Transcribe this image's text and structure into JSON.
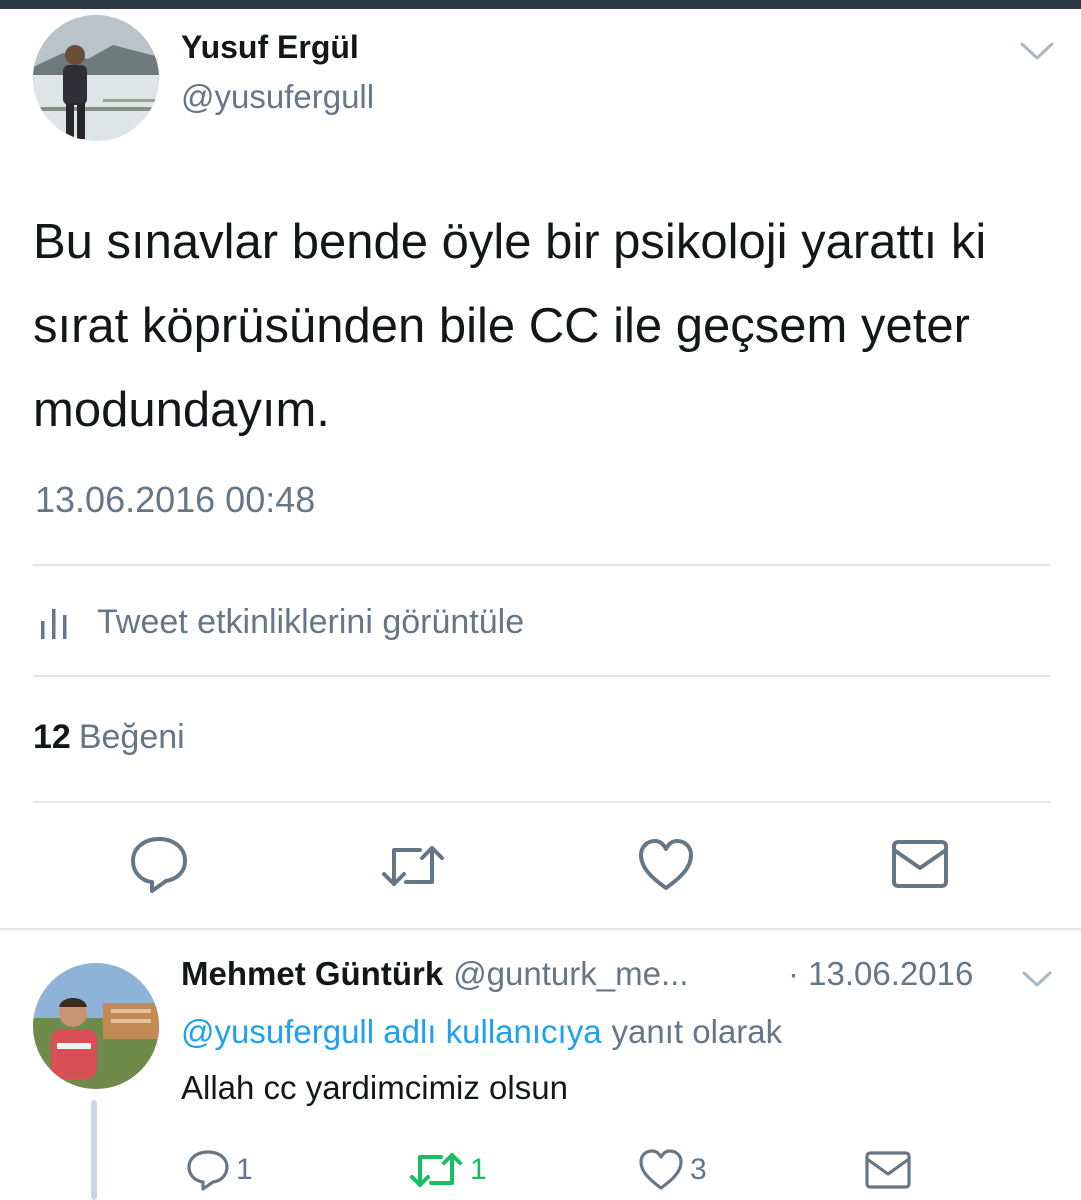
{
  "tweet": {
    "author_name": "Yusuf Ergül",
    "author_handle": "@yusufergull",
    "text": "Bu sınavlar bende öyle bir psikoloji yarattı ki sırat köprüsünden bile CC ile geçsem yeter modundayım.",
    "timestamp": "13.06.2016 00:48",
    "activity_label": "Tweet etkinliklerini görüntüle",
    "likes_count": "12",
    "likes_label": "Beğeni",
    "actions": [
      "reply-icon",
      "retweet-icon",
      "like-icon",
      "message-icon"
    ]
  },
  "reply": {
    "author_name": "Mehmet Güntürk",
    "author_handle": "@gunturk_me...",
    "time": "· 13.06.2016",
    "reply_to_link": "@yusufergull adlı kullanıcıya",
    "reply_to_rest": "yanıt olarak",
    "text": "Allah cc yardimcimiz olsun",
    "reply_count": "1",
    "retweet_count": "1",
    "like_count": "3"
  },
  "colors": {
    "text_primary": "#14171a",
    "text_secondary": "#657786",
    "link": "#1da1f2",
    "retweet_active": "#17bf63",
    "divider": "#e1e8ed",
    "icon": "#657786"
  }
}
